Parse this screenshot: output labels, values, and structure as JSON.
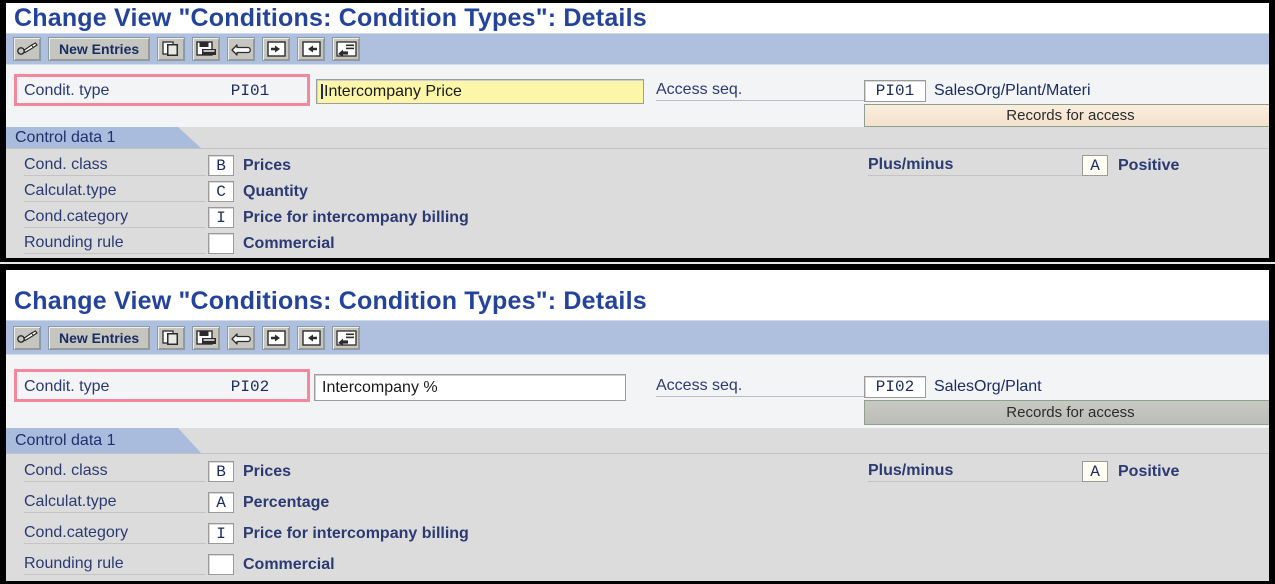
{
  "panels": [
    {
      "title": "Change View \"Conditions: Condition Types\": Details",
      "toolbar": {
        "display_change_icon": "pencil-glasses-icon",
        "new_entries_label": "New Entries",
        "copy_icon": "copy-icon",
        "save_icon": "save-icon",
        "undo_icon": "undo-icon",
        "back_icon": "back-icon",
        "exit_icon": "exit-icon",
        "cancel_icon": "cancel-icon"
      },
      "header": {
        "condit_type_label": "Condit. type",
        "condit_type_value": "PI01",
        "description_value": "Intercompany Price",
        "description_highlighted": true,
        "access_seq_label": "Access seq.",
        "access_seq_value": "PI01",
        "access_seq_text": "SalesOrg/Plant/Materi",
        "records_for_access_label": "Records for access",
        "records_button_style": "tan"
      },
      "control": {
        "tab_label": "Control data 1",
        "rows": [
          {
            "label": "Cond. class",
            "code": "B",
            "desc": "Prices"
          },
          {
            "label": "Calculat.type",
            "code": "C",
            "desc": "Quantity"
          },
          {
            "label": "Cond.category",
            "code": "I",
            "desc": "Price for intercompany billing"
          },
          {
            "label": "Rounding rule",
            "code": "",
            "desc": "Commercial"
          }
        ],
        "plus_minus_label": "Plus/minus",
        "plus_minus_code": "A",
        "plus_minus_desc": "Positive"
      }
    },
    {
      "title": "Change View \"Conditions: Condition Types\": Details",
      "toolbar": {
        "display_change_icon": "pencil-glasses-icon",
        "new_entries_label": "New Entries",
        "copy_icon": "copy-icon",
        "save_icon": "save-icon",
        "undo_icon": "undo-icon",
        "back_icon": "back-icon",
        "exit_icon": "exit-icon",
        "cancel_icon": "cancel-icon"
      },
      "header": {
        "condit_type_label": "Condit. type",
        "condit_type_value": "PI02",
        "description_value": "Intercompany %",
        "description_highlighted": false,
        "access_seq_label": "Access seq.",
        "access_seq_value": "PI02",
        "access_seq_text": "SalesOrg/Plant",
        "records_for_access_label": "Records for access",
        "records_button_style": "gray"
      },
      "control": {
        "tab_label": "Control data 1",
        "rows": [
          {
            "label": "Cond. class",
            "code": "B",
            "desc": "Prices"
          },
          {
            "label": "Calculat.type",
            "code": "A",
            "desc": "Percentage"
          },
          {
            "label": "Cond.category",
            "code": "I",
            "desc": "Price for intercompany billing"
          },
          {
            "label": "Rounding rule",
            "code": "",
            "desc": "Commercial"
          }
        ],
        "plus_minus_label": "Plus/minus",
        "plus_minus_code": "A",
        "plus_minus_desc": "Positive"
      }
    }
  ],
  "colors": {
    "title_blue": "#24439b",
    "toolbar_blue": "#aec0de",
    "highlight_pink": "#f4869e",
    "field_yellow": "#fbf6a8",
    "tab_blue": "#a9bcdd",
    "panel_gray": "#dcdcdc",
    "records_tan": "#f5e5cd",
    "records_gray": "#c4c4bf"
  }
}
